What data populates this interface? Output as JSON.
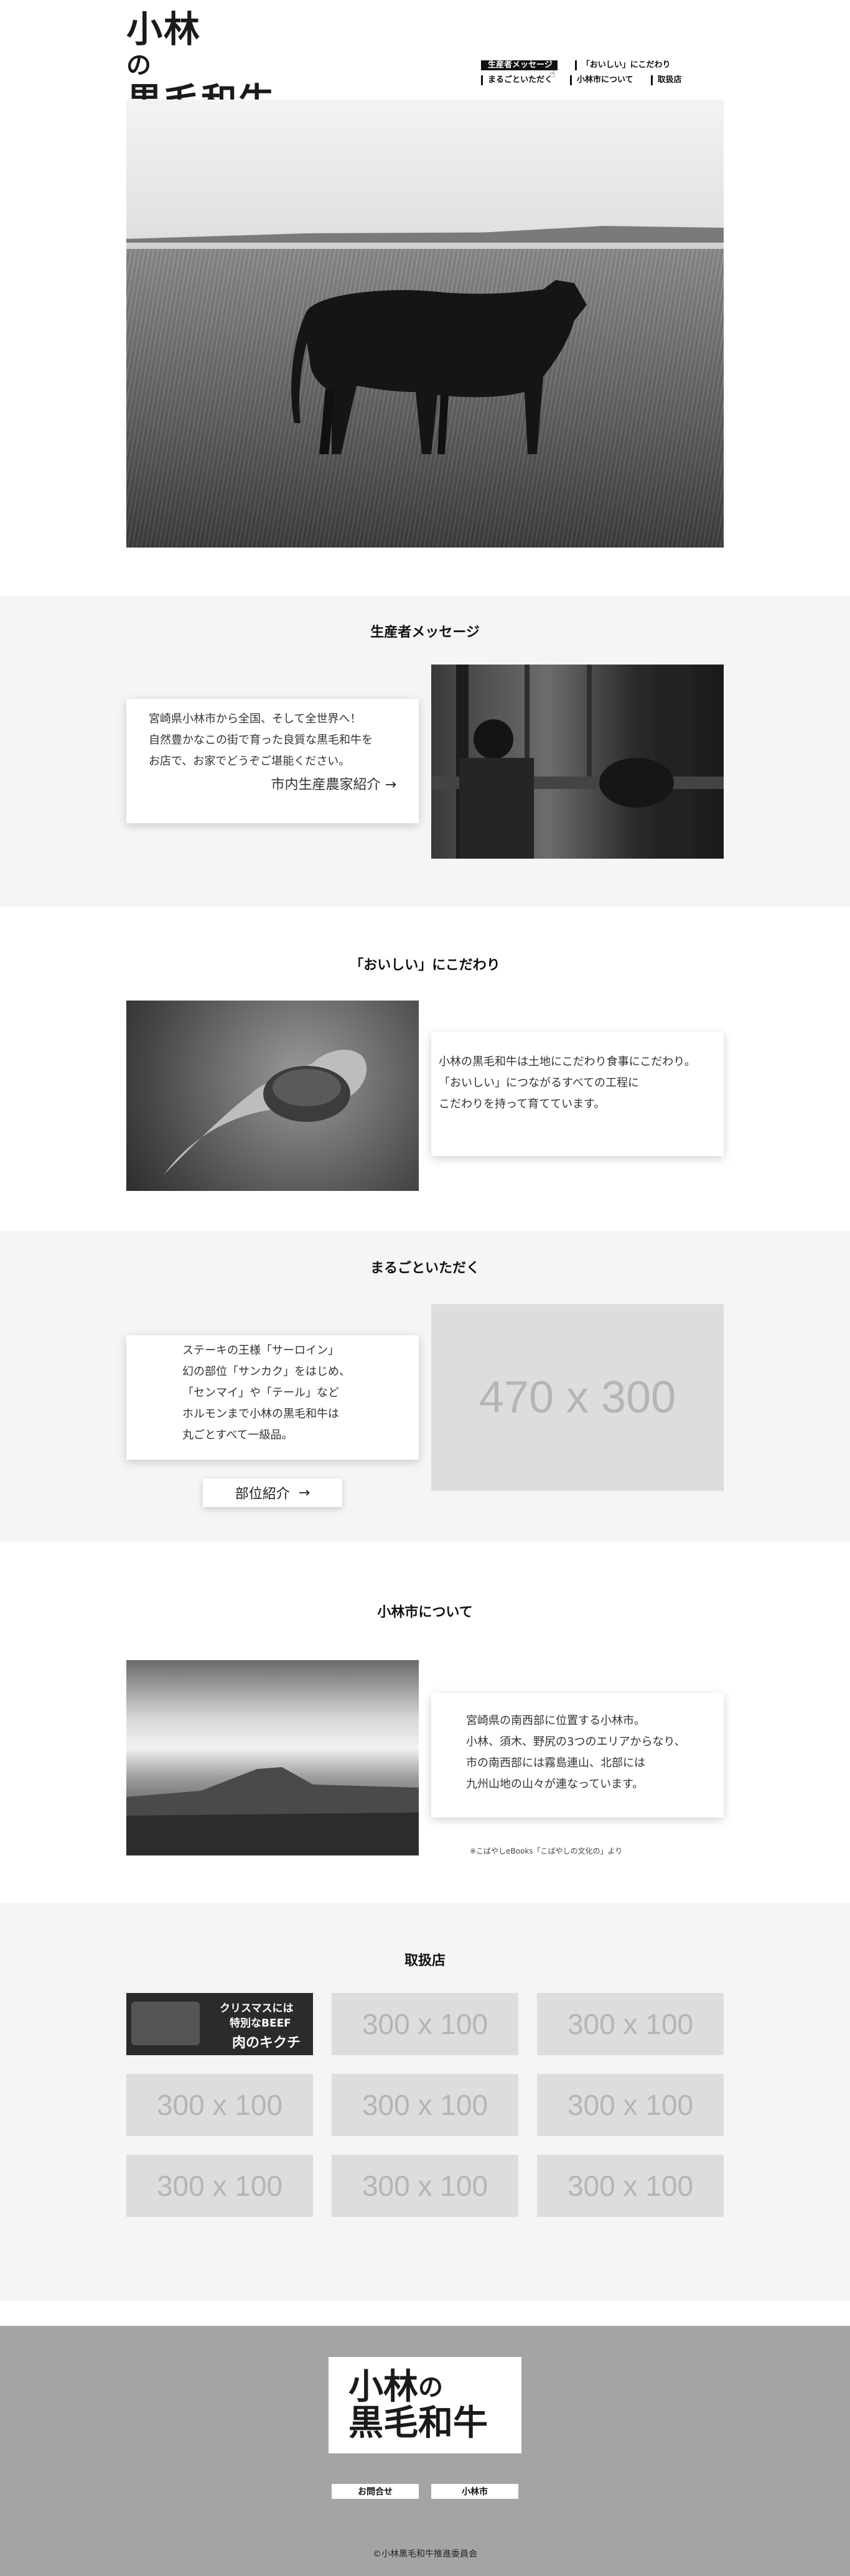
{
  "brand": {
    "line1": "小林",
    "no": "の",
    "line2": "黒毛和牛"
  },
  "nav": {
    "items": [
      {
        "label": "生産者メッセージ",
        "active": true
      },
      {
        "label": "「おいしい」にこだわり",
        "active": false
      },
      {
        "label": "まるごといただく",
        "active": false
      },
      {
        "label": "小林市について",
        "active": false
      },
      {
        "label": "取扱店",
        "active": false
      }
    ]
  },
  "producer": {
    "title": "生産者メッセージ",
    "lines": [
      "宮崎県小林市から全国、そして全世界へ！",
      "自然豊かなこの街で育った良質な黒毛和牛を",
      "お店で、お家でどうぞご堪能ください。"
    ],
    "link": "市内生産農家紹介",
    "arrow": "→"
  },
  "oishii": {
    "title": "「おいしい」にこだわり",
    "lines": [
      "小林の黒毛和牛は土地にこだわり食事にこだわり。",
      "「おいしい」につながるすべての工程に",
      "こだわりを持って育てています。"
    ]
  },
  "marugoto": {
    "title": "まるごといただく",
    "lines": [
      "ステーキの王様「サーロイン」",
      "幻の部位「サンカク」をはじめ、",
      "「センマイ」や「テール」など",
      "ホルモンまで小林の黒毛和牛は",
      "丸ごとすべて一級品。"
    ],
    "placeholder": "470 x 300",
    "button": "部位紹介",
    "arrow": "→"
  },
  "kobayashi": {
    "title": "小林市について",
    "lines": [
      "宮崎県の南西部に位置する小林市。",
      "小林、須木、野尻の3つのエリアからなり、",
      "市の南西部には霧島連山、北部には",
      "九州山地の山々が連なっています。"
    ],
    "note": "※こばやしeBooks「こばやしの文化の」より"
  },
  "shops": {
    "title": "取扱店",
    "banner": {
      "line1": "クリスマスには",
      "line2": "特別なBEEF",
      "line3": "肉のキクチ"
    },
    "placeholders": [
      "300 x 100",
      "300 x 100",
      "300 x 100",
      "300 x 100",
      "300 x 100",
      "300 x 100",
      "300 x 100",
      "300 x 100"
    ]
  },
  "footer": {
    "buttons": [
      "お問合せ",
      "小林市"
    ],
    "copyright": "©小林黒毛和牛推進委員会"
  }
}
